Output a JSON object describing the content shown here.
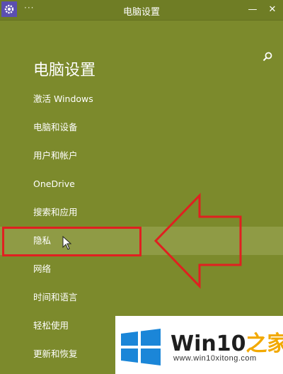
{
  "window": {
    "title": "电脑设置",
    "menu_dots": "···",
    "minimize_glyph": "—",
    "close_glyph": "✕"
  },
  "page": {
    "title": "电脑设置"
  },
  "menu": {
    "items": [
      {
        "label": "激活 Windows"
      },
      {
        "label": "电脑和设备"
      },
      {
        "label": "用户和帐户"
      },
      {
        "label": "OneDrive"
      },
      {
        "label": "搜索和应用"
      },
      {
        "label": "隐私",
        "selected": true
      },
      {
        "label": "网络"
      },
      {
        "label": "时间和语言"
      },
      {
        "label": "轻松使用"
      },
      {
        "label": "更新和恢复"
      }
    ]
  },
  "watermark": {
    "brand_main": "Win10",
    "brand_accent": "之家",
    "url": "www.win10xitong.com"
  },
  "colors": {
    "background": "#7c8a2c",
    "selected": "#8f9b45",
    "annotation_red": "#e02020",
    "logo_blue": "#1b86d8"
  },
  "icons": [
    "gear-icon",
    "search-icon",
    "mouse-cursor-icon",
    "windows-logo-icon"
  ]
}
